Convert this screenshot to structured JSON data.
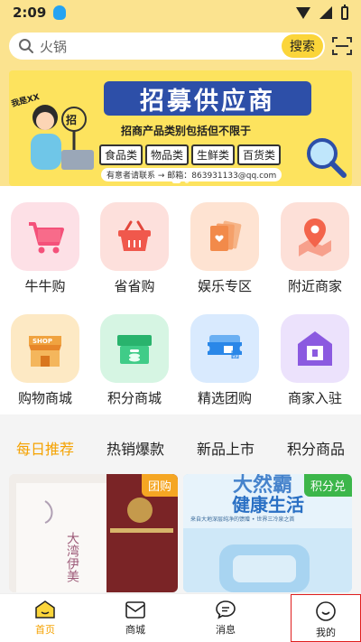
{
  "status": {
    "time": "2:09"
  },
  "search": {
    "placeholder": "火锅",
    "button": "搜索"
  },
  "banner": {
    "title": "招募供应商",
    "subtitle": "招商产品类别包括但不限于",
    "categories": [
      "食品类",
      "物品类",
      "生鲜类",
      "百货类"
    ],
    "contact": "有意者请联系 → 邮箱：863931133@qq.com",
    "stamp": "招",
    "person_sign": "我是XX"
  },
  "categories": [
    {
      "label": "牛牛购",
      "icon": "cart-icon",
      "color": "#f86b8a"
    },
    {
      "label": "省省购",
      "icon": "basket-icon",
      "color": "#f0584c"
    },
    {
      "label": "娱乐专区",
      "icon": "cards-icon",
      "color": "#f28a4a"
    },
    {
      "label": "附近商家",
      "icon": "map-pin-icon",
      "color": "#f3644b"
    },
    {
      "label": "购物商城",
      "icon": "shop-icon",
      "color": "#f0a340",
      "shop_text": "SHOP"
    },
    {
      "label": "积分商城",
      "icon": "points-box-icon",
      "color": "#33c47f"
    },
    {
      "label": "精选团购",
      "icon": "ticket-icon",
      "color": "#2a87e8",
      "ticket_text": "团"
    },
    {
      "label": "商家入驻",
      "icon": "store-house-icon",
      "color": "#8b5ae0"
    }
  ],
  "tabs": [
    {
      "label": "每日推荐",
      "active": true
    },
    {
      "label": "热销爆款",
      "active": false
    },
    {
      "label": "新品上市",
      "active": false
    },
    {
      "label": "积分商品",
      "active": false
    }
  ],
  "products": [
    {
      "badge": "团购",
      "badge_color": "#f5a623",
      "text": "大湾伊美"
    },
    {
      "badge": "积分兑",
      "badge_color": "#3cb64a",
      "headline": "健康生活",
      "top_text": "大然霸",
      "sub": "来自大地深层纯净的馈赠 • 世界三冷泉之首"
    }
  ],
  "nav": [
    {
      "label": "首页",
      "icon": "home-icon",
      "active": true
    },
    {
      "label": "商城",
      "icon": "mall-icon",
      "active": false
    },
    {
      "label": "消息",
      "icon": "message-icon",
      "active": false
    },
    {
      "label": "我的",
      "icon": "profile-icon",
      "active": false
    }
  ]
}
